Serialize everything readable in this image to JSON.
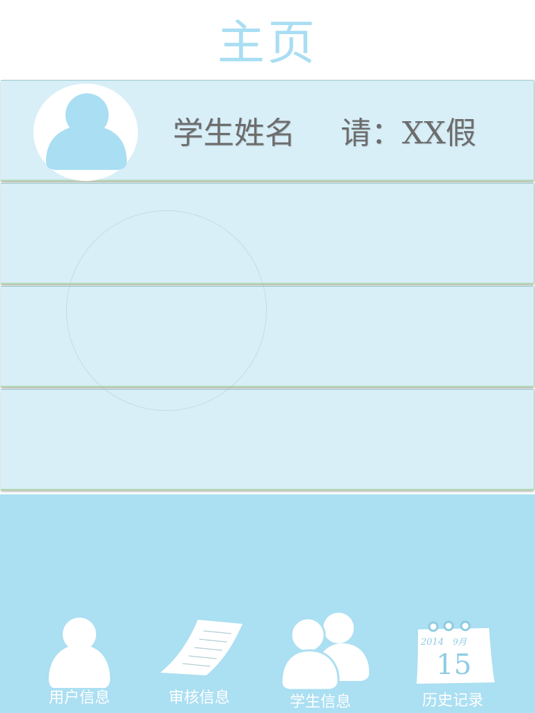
{
  "header": {
    "title": "主页"
  },
  "cards": [
    {
      "student_name": "学生姓名",
      "leave_label": "请：XX假"
    },
    {},
    {},
    {}
  ],
  "bottom_nav": {
    "items": [
      {
        "label": "用户信息",
        "icon": "user-icon"
      },
      {
        "label": "审核信息",
        "icon": "document-icon"
      },
      {
        "label": "学生信息",
        "icon": "students-icon"
      },
      {
        "label": "历史记录",
        "icon": "calendar-icon"
      }
    ],
    "calendar": {
      "year": "2014",
      "month": "9月",
      "day": "15"
    }
  },
  "colors": {
    "title": "#a9def3",
    "card_bg": "#d8eff8",
    "bottom_bg": "#abdff2",
    "avatar_fill": "#a9def3",
    "text_gray": "#6d6d6d",
    "nav_white": "#ffffff"
  }
}
